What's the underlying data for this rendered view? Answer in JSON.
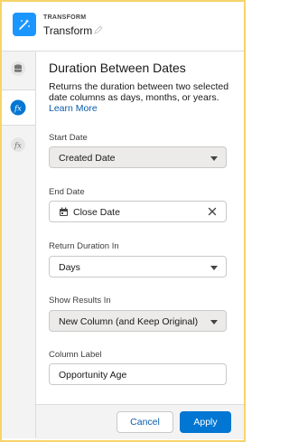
{
  "header": {
    "eyebrow": "TRANSFORM",
    "title": "Transform",
    "icon": "magic-wand-icon"
  },
  "rail": {
    "items": [
      "database-icon",
      "fx-icon",
      "fx-icon"
    ],
    "active_index": 1
  },
  "panel": {
    "title": "Duration Between Dates",
    "description": "Returns the duration between two selected date columns as days, months, or years.",
    "learn_more": "Learn More",
    "start_date": {
      "label": "Start Date",
      "value": "Created Date"
    },
    "end_date": {
      "label": "End Date",
      "value": "Close Date"
    },
    "return_duration": {
      "label": "Return Duration In",
      "value": "Days"
    },
    "show_results": {
      "label": "Show Results In",
      "value": "New Column (and Keep Original)"
    },
    "column_label": {
      "label": "Column Label",
      "value": "Opportunity Age"
    }
  },
  "footer": {
    "cancel": "Cancel",
    "apply": "Apply"
  },
  "colors": {
    "accent": "#0176d3",
    "brand_icon": "#1b96ff",
    "frame": "#f6d46a"
  }
}
